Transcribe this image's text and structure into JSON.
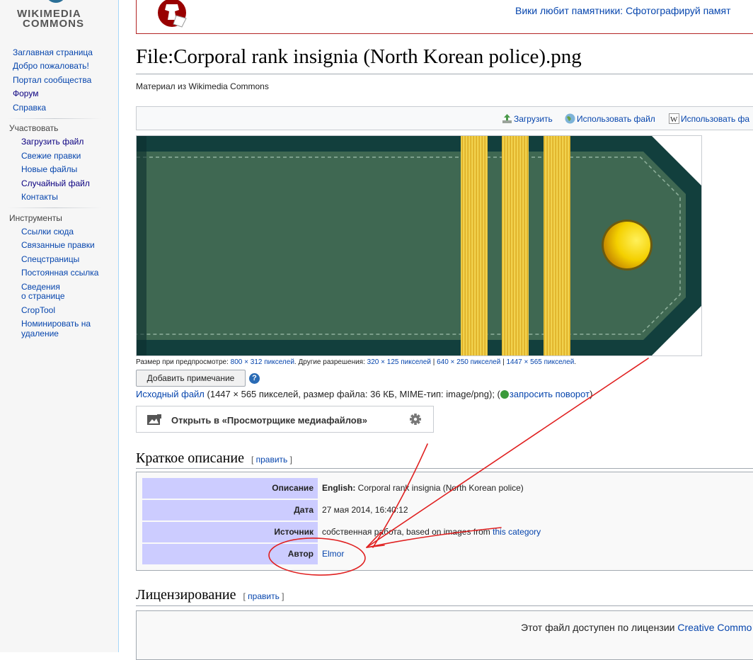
{
  "sidebar": {
    "logo": {
      "line1": "WIKIMEDIA",
      "line2": "COMMONS"
    },
    "nav_items": [
      "Заглавная страница",
      "Добро пожаловать!",
      "Портал сообщества",
      "Форум",
      "Справка"
    ],
    "participate": {
      "heading": "Участвовать",
      "items": [
        "Загрузить файл",
        "Свежие правки",
        "Новые файлы",
        "Случайный файл",
        "Контакты"
      ]
    },
    "tools": {
      "heading": "Инструменты",
      "items": [
        "Ссылки сюда",
        "Связанные правки",
        "Спецстраницы",
        "Постоянная ссылка",
        "Сведения",
        "о странице",
        "CropTool",
        "Номинировать на",
        "удаление"
      ]
    }
  },
  "banner": {
    "text": "Вики любит памятники: Сфотографируй памят"
  },
  "page": {
    "title": "File:Corporal rank insignia (North Korean police).png",
    "subtitle": "Материал из Wikimedia Commons"
  },
  "toolbar": {
    "upload": "Загрузить",
    "use_file": "Использовать файл",
    "use_file_wiki": "Использовать фа"
  },
  "file_info": {
    "preview_label": "Размер при предпросмотре:",
    "preview_size": "800 × 312 пикселей",
    "other_res_label": ". Другие разрешения:",
    "res1": "320 × 125 пикселей",
    "sep": " | ",
    "res2": "640 × 250 пикселей",
    "res3": "1447 × 565 пикселей",
    "end": "."
  },
  "annotate_button": "Добавить примечание",
  "help_glyph": "?",
  "original": {
    "link": "Исходный файл",
    "details": " (1447 × 565 пикселей, размер файла: 36 КБ, MIME-тип: image/png); (",
    "rotate_link": "запросить поворот",
    "close": ")"
  },
  "mediaviewer": {
    "label": "Открыть в «Просмотрщике медиафайлов»"
  },
  "summary": {
    "heading": "Краткое описание",
    "edit_open": "[ ",
    "edit_link": "править",
    "edit_close": " ]",
    "rows": [
      {
        "key": "Описание",
        "val_bold": "English:",
        "val": " Corporal rank insignia (North Korean police)"
      },
      {
        "key": "Дата",
        "val": "27 мая 2014, 16:40:12"
      },
      {
        "key": "Источник",
        "val": "собственная работа, based on images from ",
        "val_link": "this category"
      },
      {
        "key": "Автор",
        "val_link": "Elmor"
      }
    ]
  },
  "licensing": {
    "heading": "Лицензирование",
    "edit_open": "[ ",
    "edit_link": "править",
    "edit_close": " ]",
    "text": "Этот файл доступен по лицензии ",
    "link": "Creative Commo"
  },
  "colors": {
    "link": "#0645ad",
    "table_key_bg": "#ccccff",
    "insignia_green": "#3f6852",
    "insignia_border": "#123f3d",
    "stripe_gold": "#f0cc3c",
    "annotation_red": "#e02020"
  }
}
